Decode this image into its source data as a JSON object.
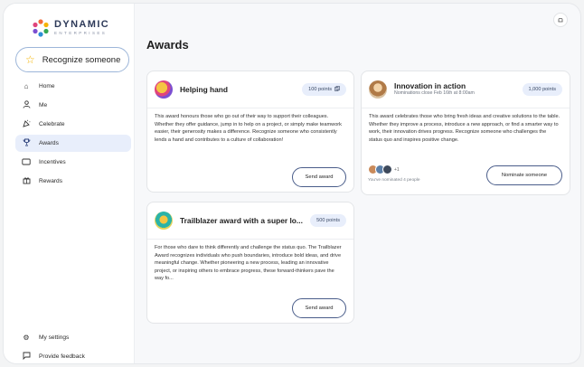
{
  "brand": {
    "name": "DYNAMIC",
    "sub": "ENTERPRISES"
  },
  "sidebar": {
    "recognize_label": "Recognize someone",
    "items": [
      {
        "label": "Home",
        "icon": "home-icon"
      },
      {
        "label": "Me",
        "icon": "person-icon"
      },
      {
        "label": "Celebrate",
        "icon": "celebrate-icon"
      },
      {
        "label": "Awards",
        "icon": "trophy-icon",
        "active": true
      },
      {
        "label": "Incentives",
        "icon": "ticket-icon"
      },
      {
        "label": "Rewards",
        "icon": "gift-icon"
      }
    ],
    "bottom_items": [
      {
        "label": "My settings",
        "icon": "gear-icon"
      },
      {
        "label": "Provide feedback",
        "icon": "feedback-icon"
      }
    ]
  },
  "main": {
    "title": "Awards",
    "cards": [
      {
        "title": "Helping hand",
        "points": "100 points",
        "body": "This award honours those who go out of their way to support their colleagues. Whether they offer guidance, jump in to help on a project, or simply make teamwork easier, their generosity makes a difference. Recognize someone who consistently lends a hand and contributes to a culture of collaboration!",
        "action": "Send award"
      },
      {
        "title": "Innovation in action",
        "subtitle": "Nominations close Feb 16th at 8:00am",
        "points": "1,000 points",
        "body": "This award celebrates those who bring fresh ideas and creative solutions to the table. Whether they improve a process, introduce a new approach, or find a smarter way to work, their innovation drives progress. Recognize someone who challenges the status quo and inspires positive change.",
        "action": "Nominate someone",
        "more_count": "+1",
        "nominated_note": "You've nominated 4 people"
      },
      {
        "title": "Trailblazer award with a super lo...",
        "points": "500 points",
        "body": "For those who dare to think differently and challenge the status quo. The Trailblazer Award recognizes individuals who push boundaries, introduce bold ideas, and drive meaningful change. Whether pioneering a new process, leading an innovative project, or inspiring others to embrace progress, these forward-thinkers pave the way fo...",
        "action": "Send award"
      }
    ]
  },
  "colors": {
    "accent": "#e8eefb",
    "button_border": "#4a5d8a",
    "star": "#f5b400"
  }
}
